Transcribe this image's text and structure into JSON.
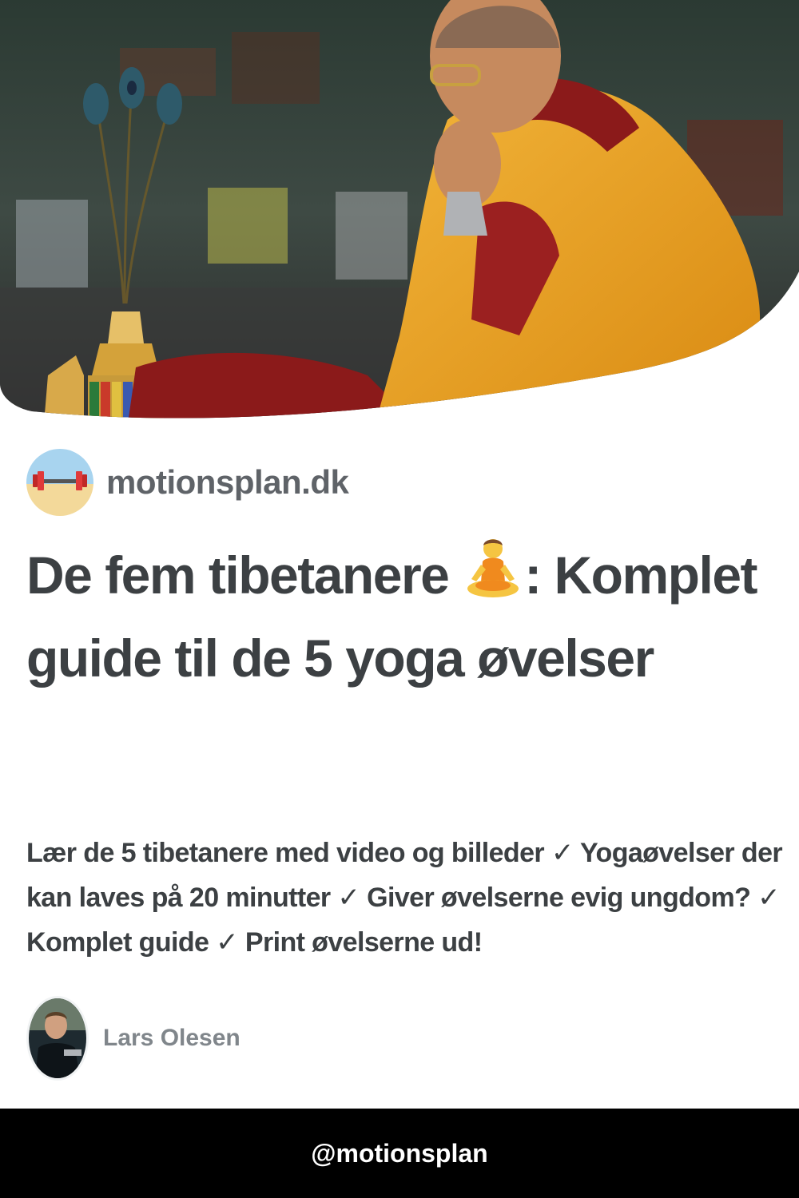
{
  "hero": {
    "subject": "monk-meditation-photo"
  },
  "site": {
    "name": "motionsplan.dk",
    "logo_icon": "dumbbell-beach-icon"
  },
  "article": {
    "title_part1": "De fem tibetanere",
    "title_emoji": "person-in-lotus-position-icon",
    "title_part2": ": Komplet guide til de 5 yoga øvelser",
    "description": "Lær de 5 tibetanere med video og billeder ✓ Yogaøvelser der kan laves på 20 minutter ✓ Giver øvelserne evig ungdom? ✓ Komplet guide ✓ Print øvelserne ud!"
  },
  "author": {
    "name": "Lars Olesen",
    "avatar_icon": "author-avatar-photo"
  },
  "footer": {
    "handle": "@motionsplan"
  },
  "colors": {
    "title": "#3c4043",
    "muted": "#5f6368",
    "footer_bg": "#000000",
    "robe": "#e8a020",
    "robe_dark": "#8b1a1a"
  }
}
